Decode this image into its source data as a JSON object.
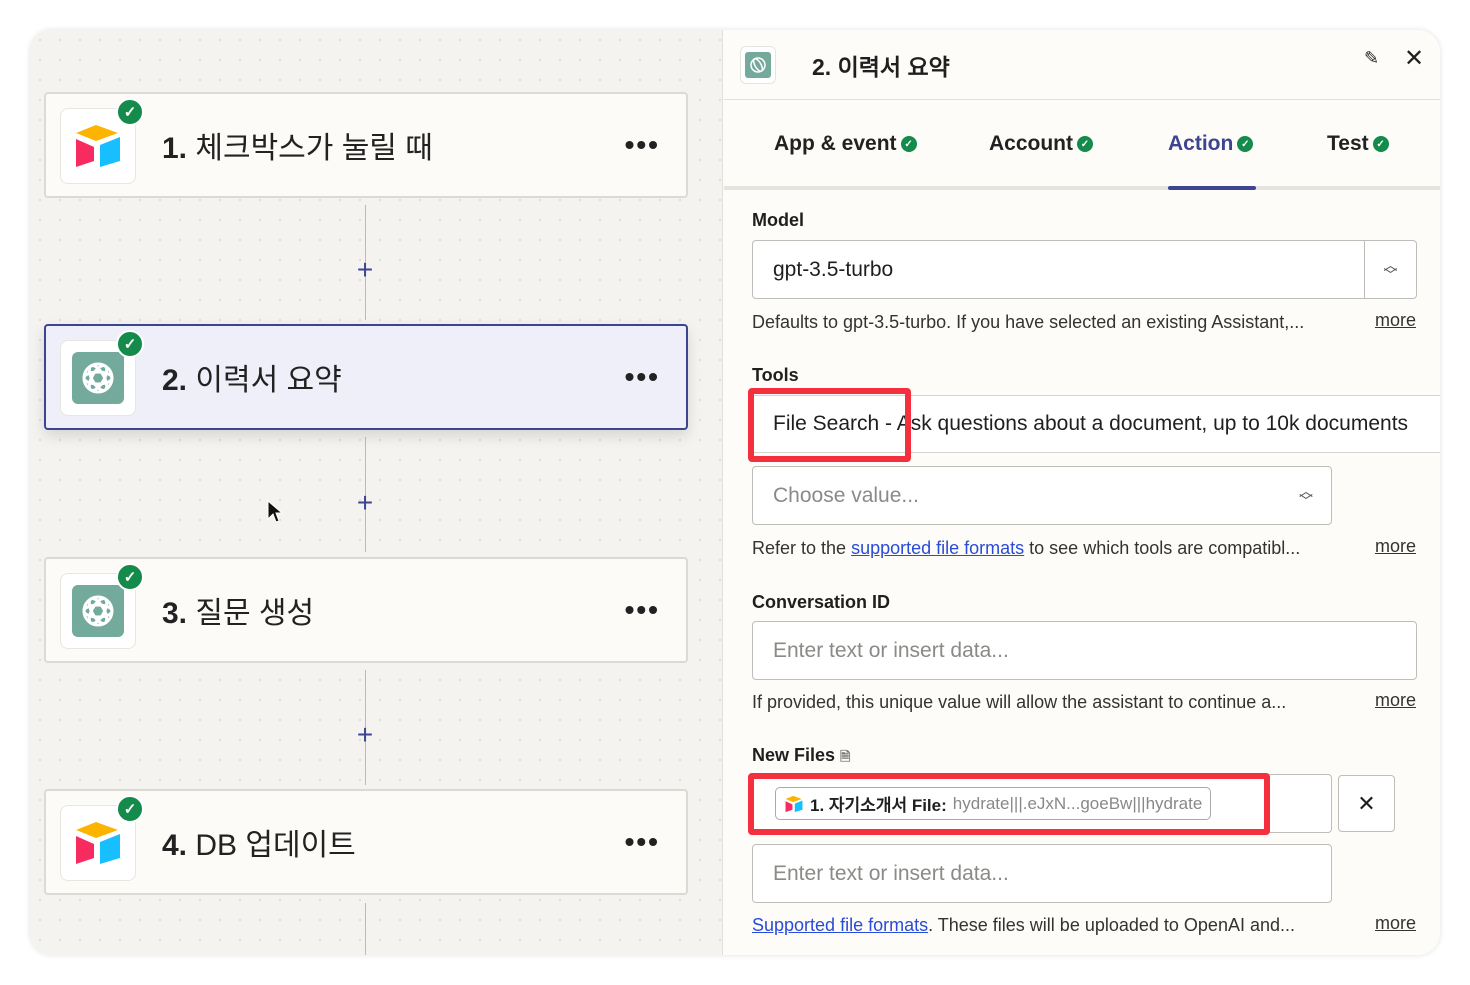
{
  "steps": [
    {
      "num": "1.",
      "title": "체크박스가 눌릴 때",
      "app": "airtable"
    },
    {
      "num": "2.",
      "title": "이력서 요약",
      "app": "openai"
    },
    {
      "num": "3.",
      "title": "질문 생성",
      "app": "openai"
    },
    {
      "num": "4.",
      "title": "DB 업데이트",
      "app": "airtable"
    }
  ],
  "menu_glyph": "•••",
  "plus_glyph": "+",
  "panel": {
    "title": "2. 이력서 요약",
    "tabs": [
      {
        "label": "App & event"
      },
      {
        "label": "Account"
      },
      {
        "label": "Action",
        "active": true
      },
      {
        "label": "Test"
      }
    ],
    "model": {
      "label": "Model",
      "value": "gpt-3.5-turbo",
      "help": "Defaults to gpt-3.5-turbo. If you have selected an existing Assistant,...",
      "more": "more"
    },
    "tools": {
      "label": "Tools",
      "option": "File Search - Ask questions about a document, up to 10k documents",
      "placeholder": "Choose value...",
      "help_pre": "Refer to the ",
      "help_link": "supported file formats",
      "help_post": " to see which tools are compatibl...",
      "more": "more"
    },
    "conversation": {
      "label": "Conversation ID",
      "placeholder": "Enter text or insert data...",
      "help": "If provided, this unique value will allow the assistant to continue a...",
      "more": "more"
    },
    "files": {
      "label": "New Files",
      "pill_label": "1. 자기소개서 File:",
      "pill_value": "hydrate|||.eJxN...goeBw|||hydrate",
      "placeholder": "Enter text or insert data...",
      "help_link": "Supported file formats",
      "help_post": ". These files will be uploaded to OpenAI and...",
      "more": "more"
    }
  },
  "colors": {
    "accent": "#3d4592",
    "success": "#148a4b",
    "highlight": "#f4303f"
  }
}
